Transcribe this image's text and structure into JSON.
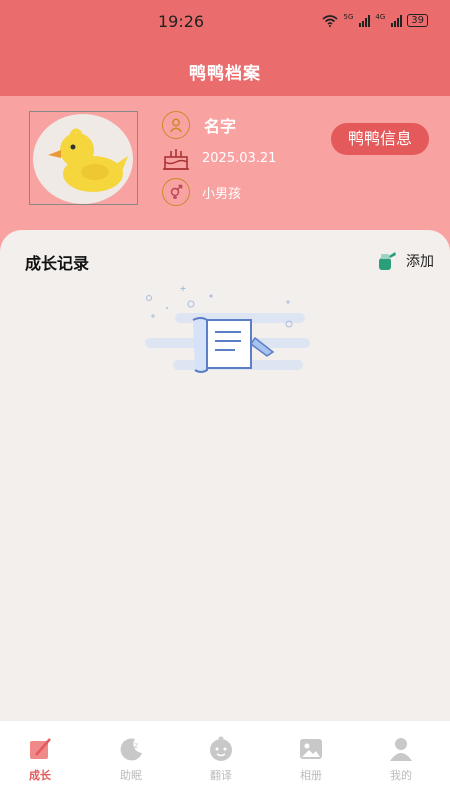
{
  "status_bar": {
    "time": "19:26",
    "signal1_label": "5G",
    "signal2_label": "4G",
    "battery": "39"
  },
  "header": {
    "title": "鸭鸭档案"
  },
  "profile": {
    "name": "名字",
    "birthday": "2025.03.21",
    "gender": "小男孩",
    "info_button": "鸭鸭信息"
  },
  "growth": {
    "title": "成长记录",
    "add_label": "添加"
  },
  "tabs": [
    {
      "label": "成长",
      "icon": "pen-icon",
      "active": true
    },
    {
      "label": "助眠",
      "icon": "moon-icon",
      "active": false
    },
    {
      "label": "翻译",
      "icon": "baby-icon",
      "active": false
    },
    {
      "label": "相册",
      "icon": "photo-icon",
      "active": false
    },
    {
      "label": "我的",
      "icon": "person-icon",
      "active": false
    }
  ],
  "colors": {
    "header": "#ea6c6c",
    "profile_bg": "#f9a2a2",
    "accent": "#e45a5a",
    "background": "#f3efec"
  }
}
